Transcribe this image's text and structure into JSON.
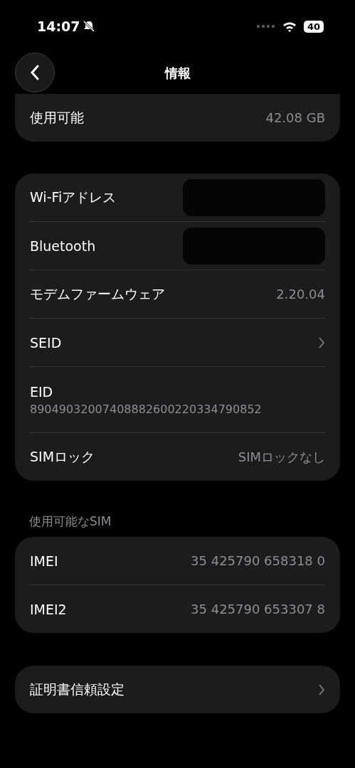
{
  "status_bar": {
    "time": "14:07",
    "silent": true,
    "battery": "40"
  },
  "nav": {
    "title": "情報"
  },
  "groups": [
    {
      "rows": [
        {
          "kind": "value",
          "label": "使用可能",
          "value": "42.08 GB"
        }
      ]
    },
    {
      "rows": [
        {
          "kind": "redacted",
          "label": "Wi-Fiアドレス"
        },
        {
          "kind": "redacted",
          "label": "Bluetooth"
        },
        {
          "kind": "value",
          "label": "モデムファームウェア",
          "value": "2.20.04"
        },
        {
          "kind": "link",
          "label": "SEID"
        },
        {
          "kind": "stacked",
          "label": "EID",
          "value": "89049032007408882600220334790852"
        },
        {
          "kind": "value",
          "label": "SIMロック",
          "value": "SIMロックなし"
        }
      ]
    },
    {
      "header": "使用可能なSIM",
      "rows": [
        {
          "kind": "value",
          "label": "IMEI",
          "value": "35 425790 658318 0"
        },
        {
          "kind": "value",
          "label": "IMEI2",
          "value": "35 425790 653307 8"
        }
      ]
    },
    {
      "rows": [
        {
          "kind": "link",
          "label": "証明書信頼設定"
        }
      ]
    }
  ]
}
